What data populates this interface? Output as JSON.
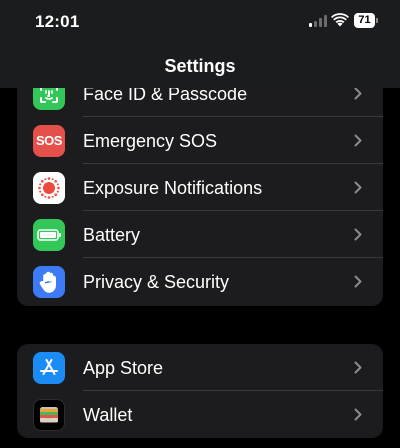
{
  "status_bar": {
    "time": "12:01",
    "battery": "71"
  },
  "nav": {
    "title": "Settings"
  },
  "group1": {
    "items": [
      {
        "label": "Face ID & Passcode",
        "icon": "face-id-icon"
      },
      {
        "label": "Emergency SOS",
        "icon": "sos-icon",
        "badge": "SOS"
      },
      {
        "label": "Exposure Notifications",
        "icon": "exposure-icon"
      },
      {
        "label": "Battery",
        "icon": "battery-icon"
      },
      {
        "label": "Privacy & Security",
        "icon": "hand-icon"
      }
    ]
  },
  "group2": {
    "items": [
      {
        "label": "App Store",
        "icon": "app-store-icon"
      },
      {
        "label": "Wallet",
        "icon": "wallet-icon"
      }
    ]
  },
  "colors": {
    "green": "#33c759",
    "red": "#e5504a",
    "blue": "#3d7bf6",
    "app_store_blue": "#1b8cf5",
    "row_bg": "#1c1c1e",
    "header_bg": "#1b1c1e"
  }
}
